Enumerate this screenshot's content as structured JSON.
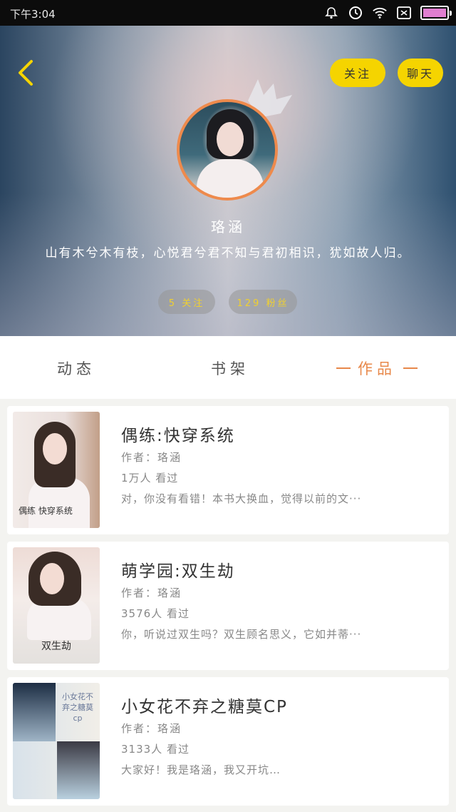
{
  "status_bar": {
    "time": "下午3:04",
    "icons": [
      "bell-icon",
      "alarm-icon",
      "wifi-icon",
      "sim-icon",
      "battery-icon"
    ],
    "battery_color": "#e07fd0"
  },
  "profile": {
    "back_icon": "chevron-left-icon",
    "follow_label": "关注",
    "chat_label": "聊天",
    "name": "珞涵",
    "bio": "山有木兮木有枝，心悦君兮君不知与君初相识，犹如故人归。",
    "following": "5 关注",
    "fans": "129 粉丝",
    "accent_color": "#f5d400",
    "avatar_border_color": "#ee8a4c"
  },
  "tabs": [
    {
      "label": "动态",
      "active": false
    },
    {
      "label": "书架",
      "active": false
    },
    {
      "label": "作品",
      "active": true
    }
  ],
  "books": [
    {
      "title": "偶练:快穿系统",
      "author": "作者：珞涵",
      "views": "1万人 看过",
      "desc": "对，你没有看错！本书大换血，觉得以前的文···",
      "cover_text": "偶练 快穿系统"
    },
    {
      "title": "萌学园:双生劫",
      "author": "作者：珞涵",
      "views": "3576人 看过",
      "desc": "你，听说过双生吗？双生顾名思义，它如并蒂···",
      "cover_text": "双生劫"
    },
    {
      "title": "小女花不弃之糖莫CP",
      "author": "作者：珞涵",
      "views": "3133人 看过",
      "desc": "大家好！我是珞涵，我又开坑…",
      "cover_text": "小女花不弃之糖莫cp"
    }
  ]
}
